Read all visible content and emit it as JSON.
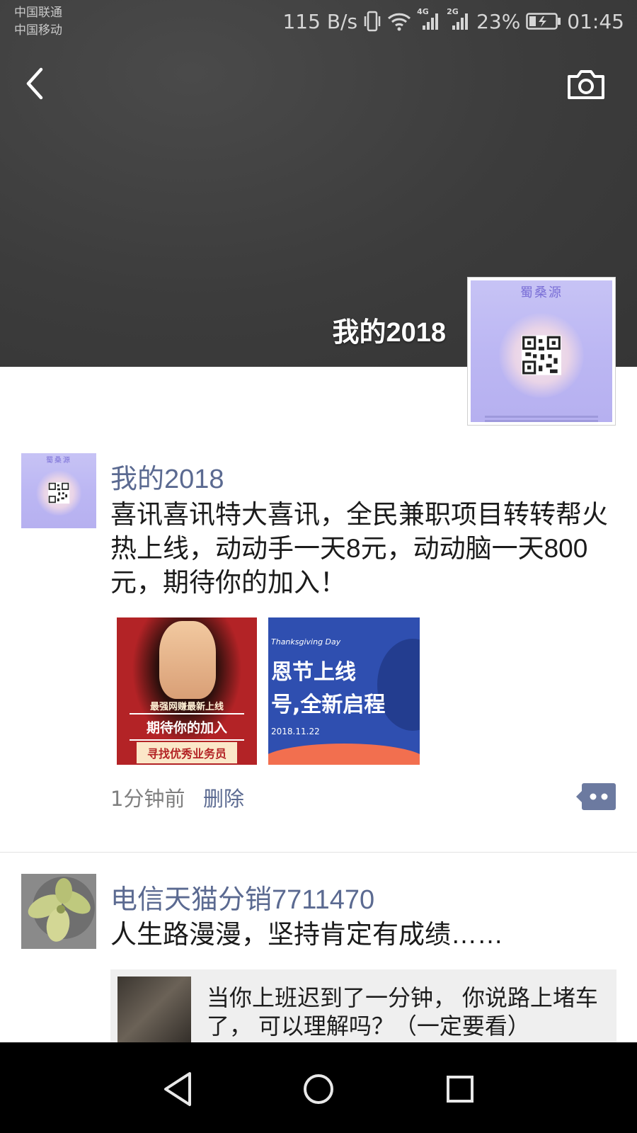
{
  "status_bar": {
    "carrier_1": "中国联通",
    "carrier_2": "中国移动",
    "net_speed": "115 B/s",
    "net_4g": "4G",
    "net_2g": "2G",
    "battery": "23%",
    "time": "01:45"
  },
  "header": {
    "cover_name": "我的2018",
    "avatar_brand": "蜀桑源"
  },
  "posts": [
    {
      "name": "我的2018",
      "avatar_brand": "蜀桑源",
      "text": "喜讯喜讯特大喜讯，全民兼职项目转转帮火热上线，动动手一天8元，动动脑一天800元，期待你的加入！",
      "images": [
        {
          "line1": "最强网赚最新上线",
          "line2": "期待你的加入",
          "line3": "寻找优秀业务员"
        },
        {
          "tag": "Thanksgiving Day",
          "line1": "恩节上线",
          "line2": "号,全新启程",
          "date": "2018.11.22"
        }
      ],
      "time": "1分钟前",
      "delete_label": "删除"
    },
    {
      "name": "电信天猫分销7711470",
      "text": "人生路漫漫，坚持肯定有成绩……",
      "link_title": "当你上班迟到了一分钟， 你说路上堵车了， 可以理解吗？（一定要看）"
    }
  ],
  "colors": {
    "name_link": "#5b6a91",
    "cover_bg": "#3c3c3c",
    "nav_bar": "#000000"
  }
}
